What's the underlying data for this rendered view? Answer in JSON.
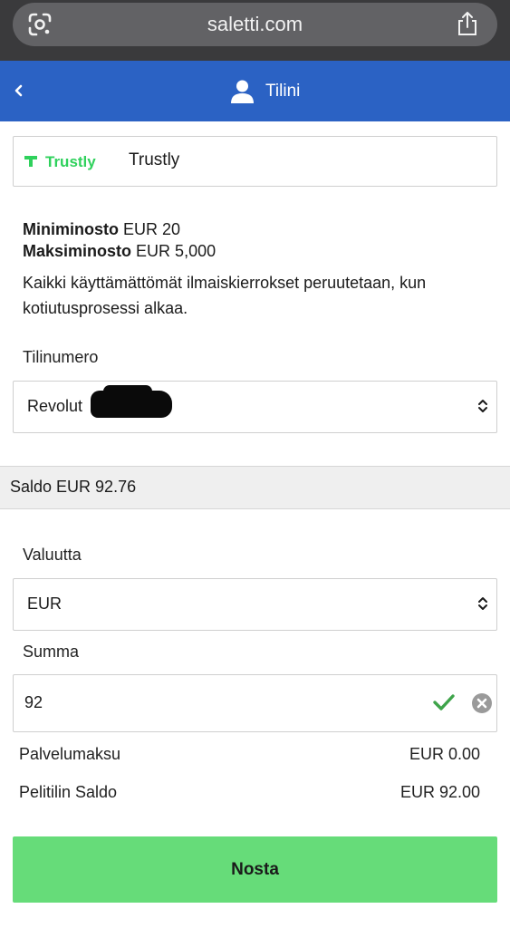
{
  "browser": {
    "url": "saletti.com",
    "icons": {
      "lens": "google-lens-icon",
      "share": "share-icon"
    }
  },
  "header": {
    "title": "Tilini",
    "accent_color": "#2b62c4",
    "icons": {
      "back": "chevron-left-icon",
      "user": "user-icon"
    }
  },
  "payment_method": {
    "logo_text": "Trustly",
    "name": "Trustly",
    "logo_color": "#2fd15c"
  },
  "limits": {
    "min_label": "Miniminosto",
    "min_value": "EUR 20",
    "max_label": "Maksiminosto",
    "max_value": "EUR 5,000",
    "note": "Kaikki käyttämättömät ilmaiskierrokset peruutetaan, kun kotiutusprosessi alkaa."
  },
  "account": {
    "label": "Tilinumero",
    "selected": "Revolut"
  },
  "balance": {
    "text": "Saldo EUR 92.76"
  },
  "currency": {
    "label": "Valuutta",
    "selected": "EUR"
  },
  "amount": {
    "label": "Summa",
    "value": "92",
    "valid_color": "#3ea44a"
  },
  "summary": {
    "fee_label": "Palvelumaksu",
    "fee_value": "EUR 0.00",
    "balance_label": "Pelitilin Saldo",
    "balance_value": "EUR 92.00"
  },
  "submit": {
    "label": "Nosta",
    "color": "#66dc79"
  }
}
